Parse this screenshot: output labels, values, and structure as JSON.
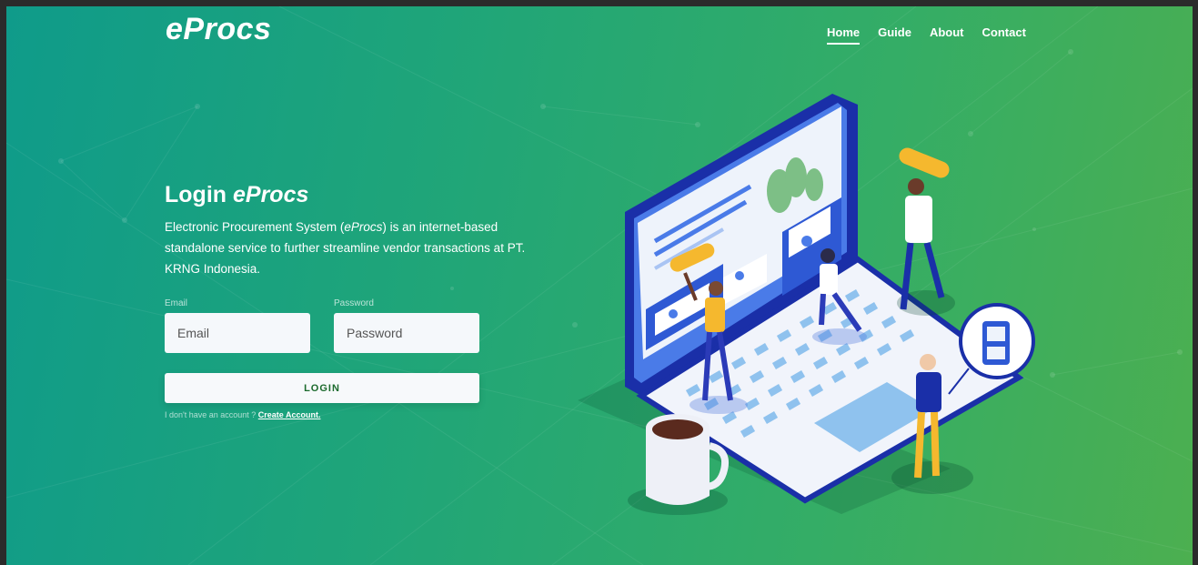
{
  "brand": {
    "logo": "eProcs"
  },
  "nav": {
    "items": [
      {
        "label": "Home",
        "active": true
      },
      {
        "label": "Guide",
        "active": false
      },
      {
        "label": "About",
        "active": false
      },
      {
        "label": "Contact",
        "active": false
      }
    ]
  },
  "hero": {
    "title_prefix": "Login ",
    "title_brand": "eProcs",
    "desc_before": "Electronic Procurement System (",
    "desc_brand": "eProcs",
    "desc_after": ") is an internet-based standalone service to further streamline vendor transactions at PT. KRNG Indonesia."
  },
  "form": {
    "email_label": "Email",
    "email_placeholder": "Email",
    "password_label": "Password",
    "password_placeholder": "Password",
    "login_label": "LOGIN",
    "signup_prompt": "I don't have an account ? ",
    "signup_link": "Create Account."
  },
  "colors": {
    "gradient_start": "#0f9b8a",
    "gradient_end": "#4caf50",
    "login_text": "#1b6a2c",
    "illustration_blue": "#1a2fa8"
  }
}
